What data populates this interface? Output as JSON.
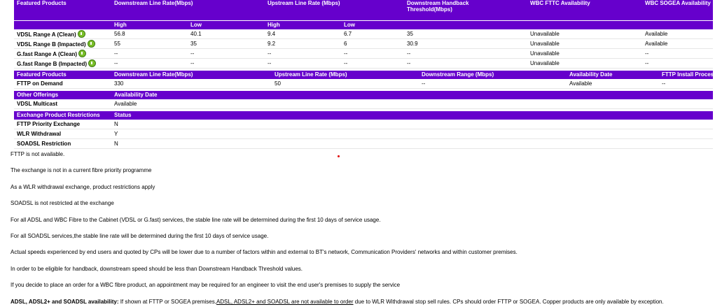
{
  "table1": {
    "headers": [
      "Featured Products",
      "Downstream Line Rate(Mbps)",
      "Upstream Line Rate (Mbps)",
      "Downstream Handback Threshold(Mbps)",
      "WBC FTTC Availability",
      "WBC SOGEA Availability"
    ],
    "handback_line1": "Downstream Handback",
    "handback_line2": "Threshold(Mbps)",
    "sub": [
      "High",
      "Low",
      "High",
      "Low"
    ],
    "rows": [
      {
        "name": "VDSL Range A (Clean)",
        "dh": "56.8",
        "dl": "40.1",
        "uh": "9.4",
        "ul": "6.7",
        "th": "35",
        "fttc": "Unavailable",
        "sogea": "Available"
      },
      {
        "name": "VDSL Range B (Impacted)",
        "dh": "55",
        "dl": "35",
        "uh": "9.2",
        "ul": "6",
        "th": "30.9",
        "fttc": "Unavailable",
        "sogea": "Available"
      },
      {
        "name": "G.fast Range A (Clean)",
        "dh": "--",
        "dl": "--",
        "uh": "--",
        "ul": "--",
        "th": "--",
        "fttc": "Unavailable",
        "sogea": "--"
      },
      {
        "name": "G.fast Range B (Impacted)",
        "dh": "--",
        "dl": "--",
        "uh": "--",
        "ul": "--",
        "th": "--",
        "fttc": "Unavailable",
        "sogea": "--"
      }
    ]
  },
  "table2": {
    "headers": [
      "Featured Products",
      "Downstream Line Rate(Mbps)",
      "Upstream Line Rate (Mbps)",
      "Downstream Range (Mbps)",
      "Availability Date",
      "FTTP Install Process"
    ],
    "row": {
      "name": "FTTP on Demand",
      "down": "330",
      "up": "50",
      "range": "--",
      "date": "Available",
      "install": "--"
    }
  },
  "table3": {
    "headers": [
      "Other Offerings",
      "Availability Date"
    ],
    "row": {
      "name": "VDSL Multicast",
      "value": "Available"
    }
  },
  "table4": {
    "headers": [
      "Exchange Product Restrictions",
      "Status"
    ],
    "rows": [
      {
        "name": "FTTP Priority Exchange",
        "value": "N"
      },
      {
        "name": "WLR Withdrawal",
        "value": "Y"
      },
      {
        "name": "SOADSL Restriction",
        "value": "N"
      }
    ]
  },
  "notes": [
    "FTTP is not available.",
    "The exchange is not in a current fibre priority programme",
    "As a WLR withdrawal exchange, product restrictions apply",
    "SOADSL is not restricted at the exchange",
    "For all ADSL and WBC Fibre to the Cabinet (VDSL or G.fast) services, the stable line rate will be determined during the first 10 days of service usage.",
    "For all SOADSL services,the stable line rate will be determined during the first 10 days of service usage.",
    "Actual speeds experienced by end users and quoted by CPs will be lower due to a number of factors within and external to BT's network, Communication Providers' networks and within customer premises.",
    "In order to be eligible for handback, downstream speed should be less than Downstream Handback Threshold values.",
    "If you decide to place an order for a WBC fibre product, an appointment may be required for an engineer to visit the end user's premises to supply the service"
  ],
  "last_note": {
    "bold": "ADSL, ADSL2+ and SOADSL availability:",
    "part1": " If shown at FTTP or SOGEA premises,",
    "underlined": "ADSL, ADSL2+ and SOADSL are not available to order",
    "part2": " due to WLR Withdrawal stop sell rules. CPs should order FTTP or SOGEA. Copper products are only available by exception."
  },
  "colors": {
    "header_bg": "#6600cc",
    "info_icon": "#7bbf2a"
  },
  "icons": {
    "info": "info-icon"
  }
}
